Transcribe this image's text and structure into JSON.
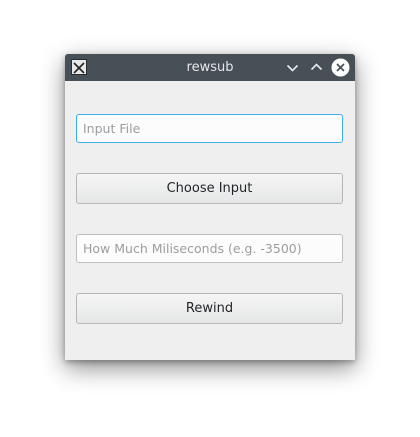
{
  "window": {
    "title": "rewsub",
    "app_icon": "x11-app-icon",
    "controls": {
      "minimize": "chevron-down-icon",
      "maximize": "chevron-up-icon",
      "close": "close-icon"
    }
  },
  "form": {
    "input_file": {
      "value": "",
      "placeholder": "Input File"
    },
    "choose_input_label": "Choose Input",
    "milliseconds": {
      "value": "",
      "placeholder": "How Much Miliseconds (e.g. -3500)"
    },
    "rewind_label": "Rewind"
  },
  "colors": {
    "titlebar": "#475057",
    "focus_accent": "#3daee9",
    "close_button": "#ffffff"
  }
}
